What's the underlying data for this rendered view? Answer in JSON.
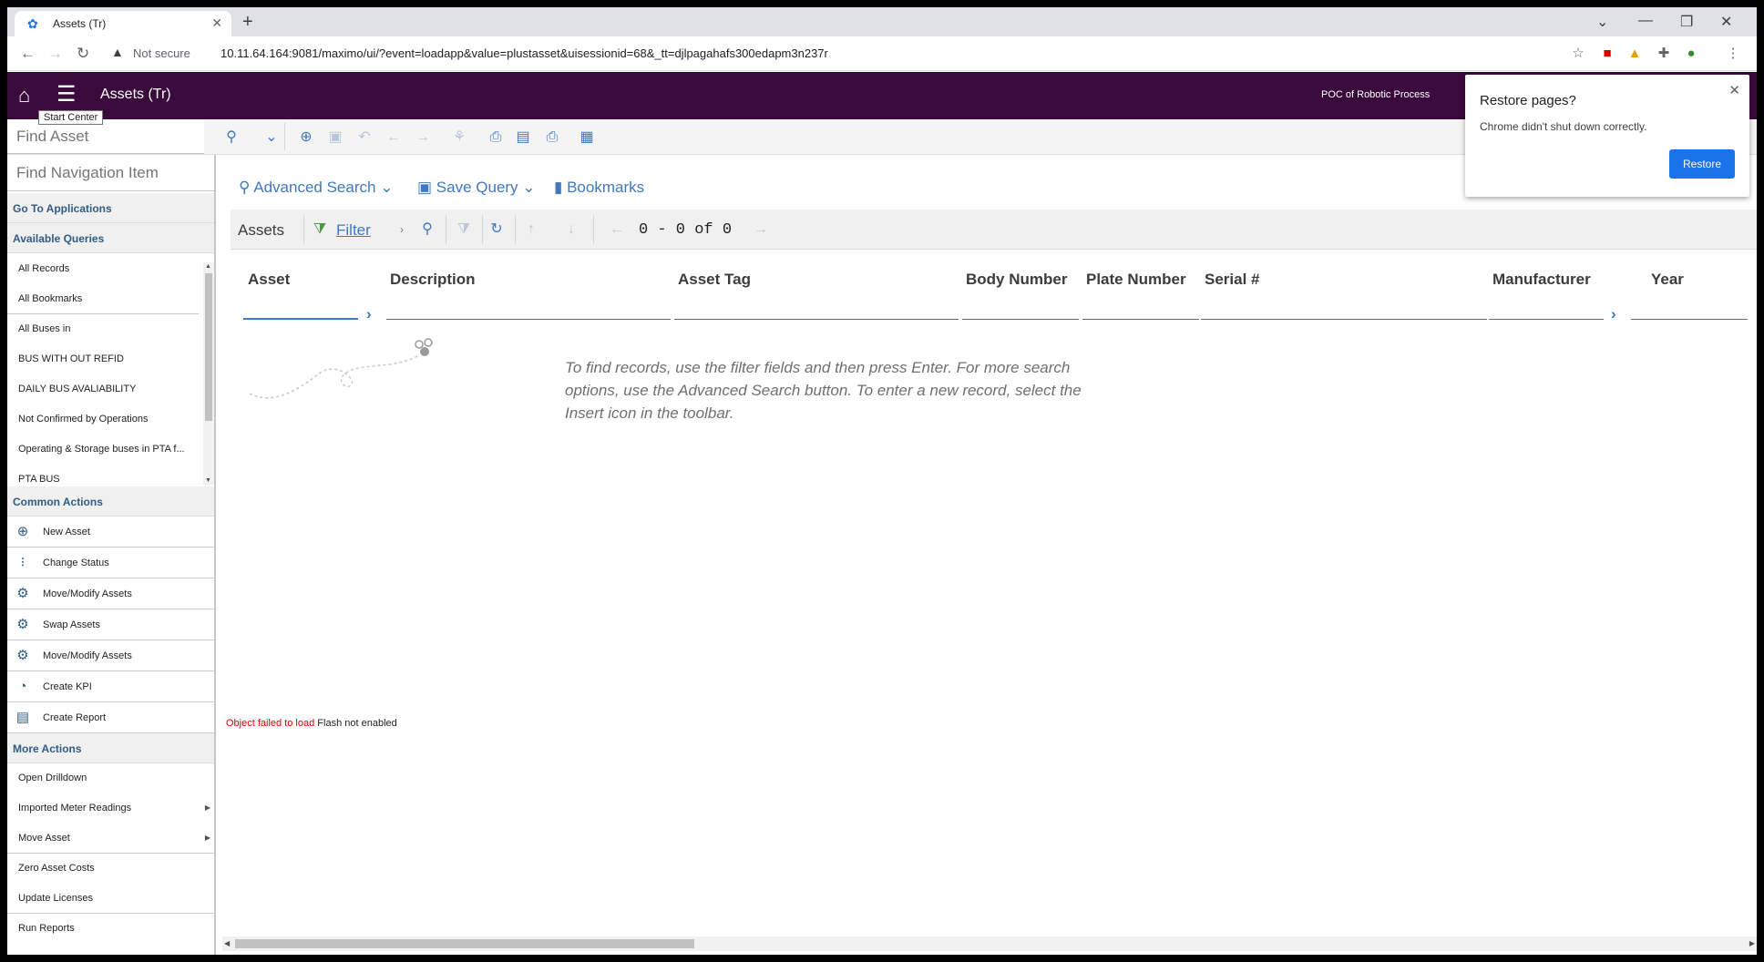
{
  "browser": {
    "tab_title": "Assets (Tr)",
    "not_secure": "Not secure",
    "url": "10.11.64.164:9081/maximo/ui/?event=loadapp&value=plustasset&uisessionid=68&_tt=djlpagahafs300edapm3n237r"
  },
  "header": {
    "app_title": "Assets (Tr)",
    "org": "POC of Robotic Process",
    "tooltip": "Start Center"
  },
  "toolbar": {
    "find_placeholder": "Find Asset"
  },
  "sidebar": {
    "find_nav_placeholder": "Find Navigation Item",
    "go_to": "Go To Applications",
    "queries_header": "Available Queries",
    "queries": [
      "All Records",
      "All Bookmarks",
      "All Buses in",
      "BUS WITH OUT REFID",
      "DAILY BUS AVALIABILITY",
      "Not Confirmed by Operations",
      "Operating & Storage buses in PTA f...",
      "PTA BUS"
    ],
    "common_header": "Common Actions",
    "common": [
      "New Asset",
      "Change Status",
      "Move/Modify Assets",
      "Swap Assets",
      "Move/Modify Assets",
      "Create KPI",
      "Create Report"
    ],
    "more_header": "More Actions",
    "more": [
      "Open Drilldown",
      "Imported Meter Readings",
      "Move Asset",
      "Zero Asset Costs",
      "Update Licenses",
      "Run Reports"
    ]
  },
  "main": {
    "advanced_search": "Advanced Search",
    "save_query": "Save Query",
    "bookmarks": "Bookmarks",
    "list_title": "Assets",
    "filter": "Filter",
    "count": "0 - 0 of 0",
    "columns": [
      "Asset",
      "Description",
      "Asset Tag",
      "Body Number",
      "Plate Number",
      "Serial #",
      "Manufacturer",
      "Year"
    ],
    "empty_message": "To find records, use the filter fields and then press Enter. For more search options, use the Advanced Search button. To enter a new record, select the Insert icon in the toolbar.",
    "flash_error": "Object failed to load",
    "flash_msg": "Flash not enabled"
  },
  "restore_popup": {
    "title": "Restore pages?",
    "message": "Chrome didn't shut down correctly.",
    "button": "Restore"
  },
  "colors": {
    "header_bg": "#3b0a3d",
    "link_blue": "#4178be",
    "chrome_blue": "#1a73e8"
  }
}
